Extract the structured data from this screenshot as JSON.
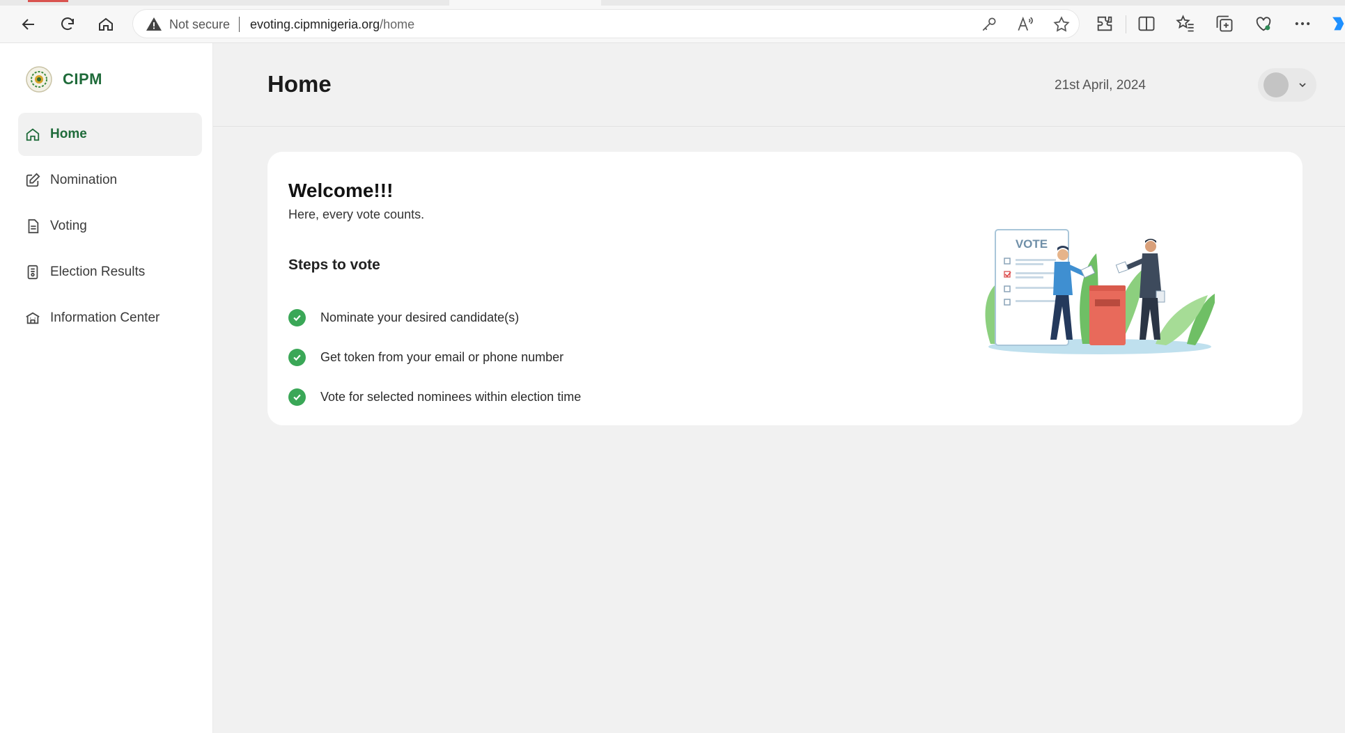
{
  "browser": {
    "security_label": "Not secure",
    "url_host": "evoting.cipmnigeria.org",
    "url_path": "/home"
  },
  "brand": {
    "name": "CIPM",
    "color": "#1f6b3a"
  },
  "sidebar": {
    "items": [
      {
        "label": "Home",
        "icon": "home-icon",
        "active": true
      },
      {
        "label": "Nomination",
        "icon": "edit-icon",
        "active": false
      },
      {
        "label": "Voting",
        "icon": "document-icon",
        "active": false
      },
      {
        "label": "Election Results",
        "icon": "results-icon",
        "active": false
      },
      {
        "label": "Information Center",
        "icon": "building-icon",
        "active": false
      }
    ]
  },
  "header": {
    "title": "Home",
    "date": "21st April, 2024"
  },
  "welcome_card": {
    "title": "Welcome!!!",
    "subtitle": "Here, every vote counts.",
    "steps_title": "Steps to vote",
    "steps": [
      "Nominate your desired candidate(s)",
      "Get token from your email or phone number",
      "Vote for selected nominees within election time"
    ],
    "illustration_label": "VOTE",
    "check_color": "#3aa757"
  }
}
